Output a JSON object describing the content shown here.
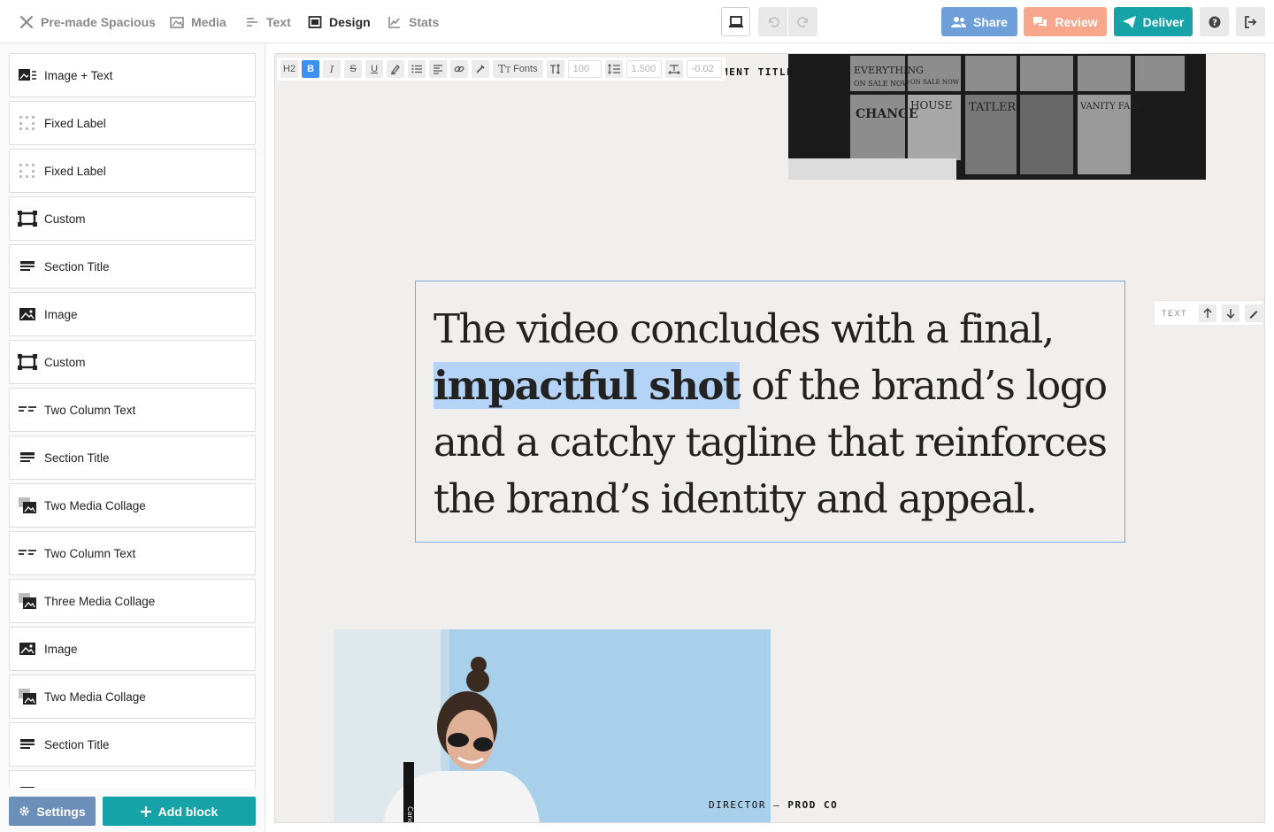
{
  "nav": {
    "brand": "Pre-made Spacious",
    "media": "Media",
    "text": "Text",
    "design": "Design",
    "stats": "Stats"
  },
  "actions": {
    "share": "Share",
    "review": "Review",
    "deliver": "Deliver"
  },
  "colors": {
    "share": "#6f9fd8",
    "review": "#f8a78c",
    "deliver": "#15a3a8",
    "settings": "#6c8fb9",
    "add_block": "#15a3a8",
    "highlight": "#b4d3f6"
  },
  "sidebar": {
    "blocks": [
      {
        "label": "Image + Text",
        "icon": "image-text-icon"
      },
      {
        "label": "Fixed Label",
        "icon": "grid-dots-icon"
      },
      {
        "label": "Fixed Label",
        "icon": "grid-dots-icon"
      },
      {
        "label": "Custom",
        "icon": "frame-icon"
      },
      {
        "label": "Section Title",
        "icon": "section-title-icon"
      },
      {
        "label": "Image",
        "icon": "image-icon"
      },
      {
        "label": "Custom",
        "icon": "frame-icon"
      },
      {
        "label": "Two Column Text",
        "icon": "two-column-icon"
      },
      {
        "label": "Section Title",
        "icon": "section-title-icon"
      },
      {
        "label": "Two Media Collage",
        "icon": "collage-icon"
      },
      {
        "label": "Two Column Text",
        "icon": "two-column-icon"
      },
      {
        "label": "Three Media Collage",
        "icon": "collage-icon"
      },
      {
        "label": "Image",
        "icon": "image-icon"
      },
      {
        "label": "Two Media Collage",
        "icon": "collage-icon"
      },
      {
        "label": "Section Title",
        "icon": "section-title-icon"
      }
    ],
    "settings": "Settings",
    "add_block": "Add block"
  },
  "toolbar": {
    "heading": "H2",
    "bold": "B",
    "italic": "I",
    "strike": "S",
    "underline": "U",
    "fonts": "Fonts",
    "size_value": "100",
    "line_height_value": "1.500",
    "letter_spacing_value": "-0.02"
  },
  "content": {
    "caption_top": "MENT TITLE — CLIENT",
    "text_before": "The video concludes with a final, ",
    "text_highlight": "impactful shot",
    "text_after": " of the brand’s logo and a catchy tagline that reinforces the brand’s identity and appeal.",
    "caption_bottom_a": "DIRECTOR",
    "caption_bottom_sep": " — ",
    "caption_bottom_b": "PROD CO",
    "side_label": "TEXT"
  }
}
